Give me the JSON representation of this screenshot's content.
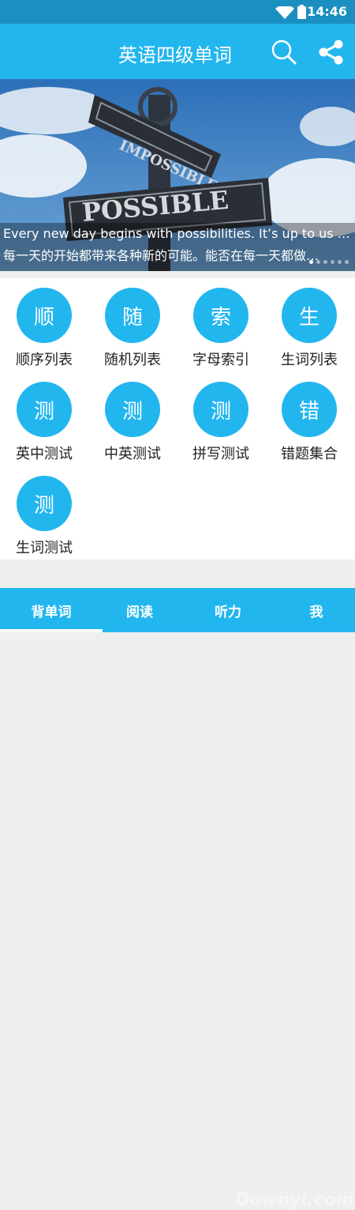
{
  "status": {
    "time": "14:46"
  },
  "header": {
    "title": "英语四级单词"
  },
  "banner": {
    "sign_top": "IMPOSSIBLE",
    "sign_bottom": "POSSIBLE",
    "caption_en": "Every new day begins with possibilities. It’s up to us to …",
    "caption_zh": "每一天的开始都带来各种新的可能。能否在每一天都做…",
    "page_count": 6
  },
  "menu": [
    {
      "glyph": "顺",
      "label": "顺序列表"
    },
    {
      "glyph": "随",
      "label": "随机列表"
    },
    {
      "glyph": "索",
      "label": "字母索引"
    },
    {
      "glyph": "生",
      "label": "生词列表"
    },
    {
      "glyph": "测",
      "label": "英中测试"
    },
    {
      "glyph": "测",
      "label": "中英测试"
    },
    {
      "glyph": "测",
      "label": "拼写测试"
    },
    {
      "glyph": "错",
      "label": "错题集合"
    },
    {
      "glyph": "测",
      "label": "生词测试"
    }
  ],
  "nav": {
    "tabs": [
      "背单词",
      "阅读",
      "听力",
      "我"
    ],
    "active_index": 0
  },
  "watermark": "Downyi.com",
  "colors": {
    "primary": "#22b6ef",
    "status_bar": "#1a8fc0"
  }
}
